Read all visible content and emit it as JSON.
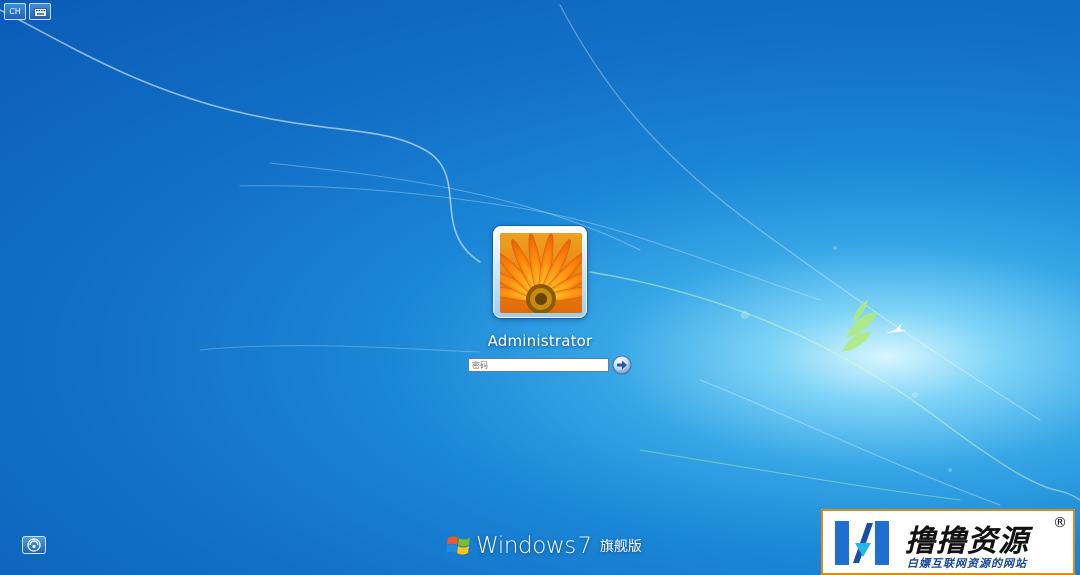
{
  "top_left": {
    "language_label": "CH",
    "language_icon": "input-language-icon",
    "keyboard_icon": "keyboard-icon"
  },
  "user": {
    "name": "Administrator",
    "picture_icon": "orange-flower-user-picture"
  },
  "password": {
    "placeholder": "密码",
    "value": "",
    "submit_icon": "arrow-right-icon"
  },
  "ease_of_access": {
    "icon": "ease-of-access-icon"
  },
  "branding": {
    "logo_icon": "windows-flag-icon",
    "name": "Windows",
    "version": "7",
    "edition": "旗舰版"
  },
  "watermark": {
    "logo_icon": "site-logo",
    "title": "撸撸资源",
    "registered": "®",
    "subtitle": "白嫖互联网资源的网站"
  },
  "colors": {
    "background_dark": "#0a5cb6",
    "background_mid": "#1a86d6",
    "background_glow": "#d8f6ff",
    "watermark_border": "#e08a16",
    "watermark_subtitle": "#17469b"
  }
}
